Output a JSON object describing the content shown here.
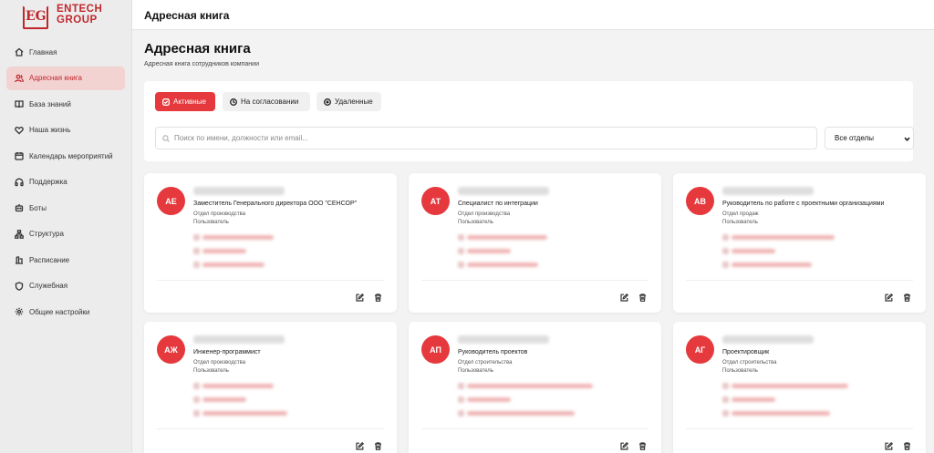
{
  "brand": {
    "mark": "EG",
    "line1": "ENTECH",
    "line2": "GROUP",
    "color": "#c0272d"
  },
  "sidebar": {
    "items": [
      {
        "label": "Главная",
        "icon": "home-icon"
      },
      {
        "label": "Адресная книга",
        "icon": "users-icon",
        "active": true
      },
      {
        "label": "База знаний",
        "icon": "book-icon"
      },
      {
        "label": "Наша жизнь",
        "icon": "heart-icon"
      },
      {
        "label": "Календарь мероприятий",
        "icon": "calendar-icon"
      },
      {
        "label": "Поддержка",
        "icon": "headphones-icon"
      },
      {
        "label": "Боты",
        "icon": "bot-icon"
      },
      {
        "label": "Структура",
        "icon": "structure-icon"
      },
      {
        "label": "Расписание",
        "icon": "schedule-icon"
      },
      {
        "label": "Служебная",
        "icon": "shield-icon"
      },
      {
        "label": "Общие настройки",
        "icon": "gear-icon"
      }
    ]
  },
  "topbar": {
    "title": "Адресная книга"
  },
  "page": {
    "title": "Адресная книга",
    "subtitle": "Адресная книга сотрудников компании"
  },
  "tabs": {
    "active": "Активные",
    "pending": "На согласовании",
    "deleted": "Удаленные"
  },
  "search": {
    "placeholder": "Поиск по имени, должности или email..."
  },
  "department_filter": {
    "value": "Все отделы"
  },
  "accent_color": "#e5393d",
  "cards": [
    {
      "initials": "АЕ",
      "position": "Заместитель Генерального директора ООО \"СЕНСОР\"",
      "department": "Отдел производства",
      "role": "Пользователь"
    },
    {
      "initials": "АТ",
      "position": "Специалист по интеграции",
      "department": "Отдел производства",
      "role": "Пользователь"
    },
    {
      "initials": "АВ",
      "position": "Руководитель по работе с проектными организациями",
      "department": "Отдел продаж",
      "role": "Пользователь"
    },
    {
      "initials": "АЖ",
      "position": "Инженер-программист",
      "department": "Отдел производства",
      "role": "Пользователь"
    },
    {
      "initials": "АП",
      "position": "Руководитель проектов",
      "department": "Отдел строительства",
      "role": "Пользователь"
    },
    {
      "initials": "АГ",
      "position": "Проектировщик",
      "department": "Отдел строительства",
      "role": "Пользователь"
    }
  ]
}
